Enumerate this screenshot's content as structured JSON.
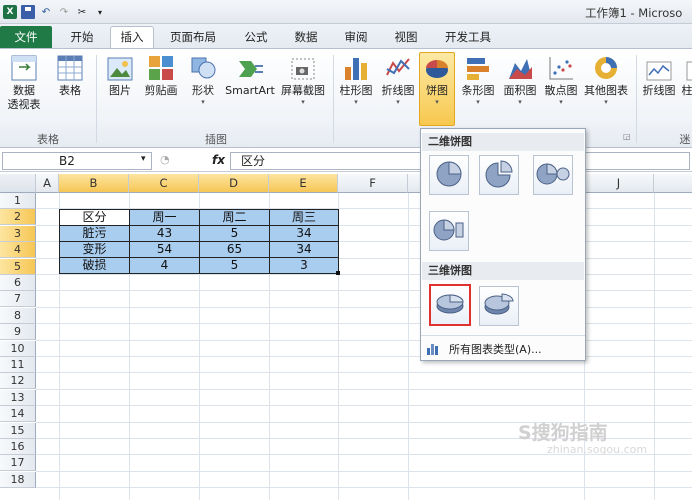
{
  "window": {
    "title": "工作簿1 - Microso"
  },
  "tabs": [
    "文件",
    "开始",
    "插入",
    "页面布局",
    "公式",
    "数据",
    "审阅",
    "视图",
    "开发工具"
  ],
  "ribbon": {
    "buttons": [
      {
        "label": "数据",
        "label2": "透视表",
        "icon": "pivot-table-icon"
      },
      {
        "label": "表格",
        "icon": "table-icon"
      },
      {
        "label": "图片",
        "icon": "picture-icon"
      },
      {
        "label": "剪贴画",
        "icon": "clipart-icon"
      },
      {
        "label": "形状",
        "icon": "shapes-icon"
      },
      {
        "label": "SmartArt",
        "icon": "smartart-icon"
      },
      {
        "label": "屏幕截图",
        "icon": "screenshot-icon"
      },
      {
        "label": "柱形图",
        "icon": "column-chart-icon"
      },
      {
        "label": "折线图",
        "icon": "line-chart-icon"
      },
      {
        "label": "饼图",
        "icon": "pie-chart-icon"
      },
      {
        "label": "条形图",
        "icon": "bar-chart-icon"
      },
      {
        "label": "面积图",
        "icon": "area-chart-icon"
      },
      {
        "label": "散点图",
        "icon": "scatter-chart-icon"
      },
      {
        "label": "其他图表",
        "icon": "other-charts-icon"
      },
      {
        "label": "折线图",
        "icon": "sparkline-line-icon"
      },
      {
        "label": "柱",
        "icon": "sparkline-column-icon"
      }
    ],
    "groups": {
      "tables": "表格",
      "illustrations": "插图",
      "sparklines": "迷"
    }
  },
  "formula_bar": {
    "name_box": "B2",
    "fx": "fx",
    "value": "区分"
  },
  "columns": [
    "A",
    "B",
    "C",
    "D",
    "E",
    "F",
    "J"
  ],
  "rows": [
    "1",
    "2",
    "3",
    "4",
    "5",
    "6",
    "7",
    "8",
    "9",
    "10",
    "11",
    "12",
    "13",
    "14",
    "15",
    "16",
    "17",
    "18"
  ],
  "table": {
    "header": [
      "区分",
      "周一",
      "周二",
      "周三"
    ],
    "rows": [
      [
        "脏污",
        "43",
        "5",
        "34"
      ],
      [
        "变形",
        "54",
        "65",
        "34"
      ],
      [
        "破损",
        "4",
        "5",
        "3"
      ]
    ]
  },
  "pie_menu": {
    "section_2d": "二维饼图",
    "section_3d": "三维饼图",
    "all_chart_types": "所有图表类型(A)...",
    "items_2d": [
      "pie",
      "exploded-pie",
      "pie-of-pie",
      "bar-of-pie"
    ],
    "items_3d": [
      "3d-pie",
      "3d-exploded-pie"
    ]
  },
  "watermark": {
    "text": "S搜狗指南",
    "sub": "zhinan.sogou.com"
  },
  "colors": {
    "file_tab": "#1f7a46",
    "selection_fill": "#a9cdef",
    "highlight": "#e03131"
  }
}
